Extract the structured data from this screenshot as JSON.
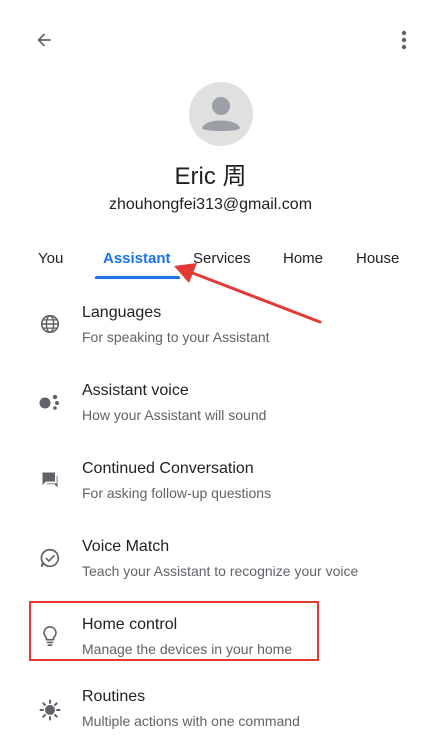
{
  "profile": {
    "name": "Eric 周",
    "email": "zhouhongfei313@gmail.com"
  },
  "tabs": [
    {
      "label": "You"
    },
    {
      "label": "Assistant"
    },
    {
      "label": "Services"
    },
    {
      "label": "Home"
    },
    {
      "label": "House"
    }
  ],
  "active_tab": "Assistant",
  "settings": [
    {
      "title": "Languages",
      "subtitle": "For speaking to your Assistant",
      "icon": "globe-icon"
    },
    {
      "title": "Assistant voice",
      "subtitle": "How your Assistant will sound",
      "icon": "assistant-dots-icon"
    },
    {
      "title": "Continued Conversation",
      "subtitle": "For asking follow-up questions",
      "icon": "chat-bubble-icon"
    },
    {
      "title": "Voice Match",
      "subtitle": "Teach your Assistant to recognize your voice",
      "icon": "voice-match-icon"
    },
    {
      "title": "Home control",
      "subtitle": "Manage the devices in your home",
      "icon": "lightbulb-icon"
    },
    {
      "title": "Routines",
      "subtitle": "Multiple actions with one command",
      "icon": "routines-icon"
    }
  ],
  "colors": {
    "accent": "#1a73e8",
    "annotation": "#e53935",
    "text_primary": "#202124",
    "text_secondary": "#5f6368"
  }
}
